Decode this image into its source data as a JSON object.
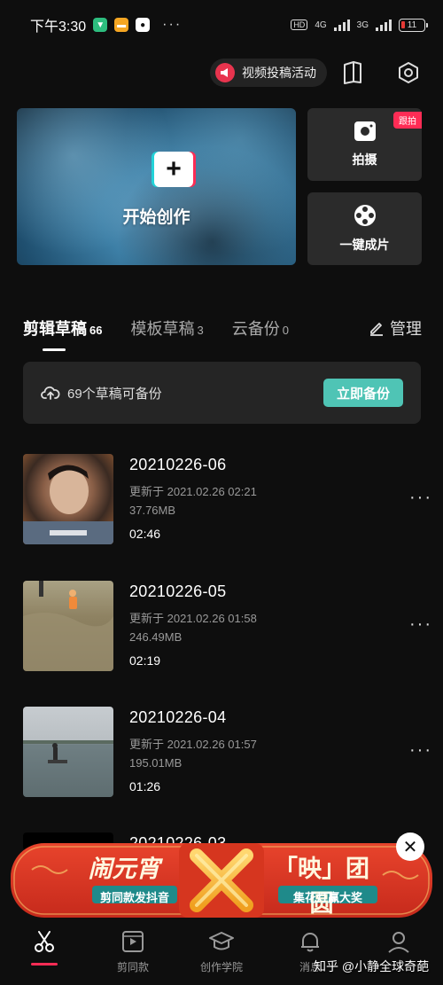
{
  "status_bar": {
    "time": "下午3:30",
    "network_hd": "HD",
    "network_1": "4G",
    "network_2": "3G",
    "battery": "11"
  },
  "header": {
    "promo_label": "视频投稿活动"
  },
  "create": {
    "main_label": "开始创作",
    "shoot_label": "拍摄",
    "shoot_tag": "跟拍",
    "oneclick_label": "一键成片"
  },
  "tabs": [
    {
      "label": "剪辑草稿",
      "count": "66"
    },
    {
      "label": "模板草稿",
      "count": "3"
    },
    {
      "label": "云备份",
      "count": "0"
    }
  ],
  "manage_label": "管理",
  "backup": {
    "text": "69个草稿可备份",
    "button": "立即备份"
  },
  "drafts": [
    {
      "title": "20210226-06",
      "updated": "更新于 2021.02.26 02:21",
      "size": "37.76MB",
      "duration": "02:46"
    },
    {
      "title": "20210226-05",
      "updated": "更新于 2021.02.26 01:58",
      "size": "246.49MB",
      "duration": "02:19"
    },
    {
      "title": "20210226-04",
      "updated": "更新于 2021.02.26 01:57",
      "size": "195.01MB",
      "duration": "01:26"
    },
    {
      "title": "20210226-03"
    }
  ],
  "banner": {
    "left_title": "闹元宵",
    "left_sub": "剪同款发抖音",
    "right_title": "「映」团圆",
    "right_sub": "集花灯赢大奖"
  },
  "bottom_nav": [
    {
      "label": ""
    },
    {
      "label": "剪同款"
    },
    {
      "label": "创作学院"
    },
    {
      "label": "消息"
    },
    {
      "label": ""
    }
  ],
  "watermark": "知乎 @小静全球奇葩",
  "colors": {
    "accent": "#fe2c55",
    "backup": "#4fc4b5",
    "cyan": "#22d3d8"
  }
}
